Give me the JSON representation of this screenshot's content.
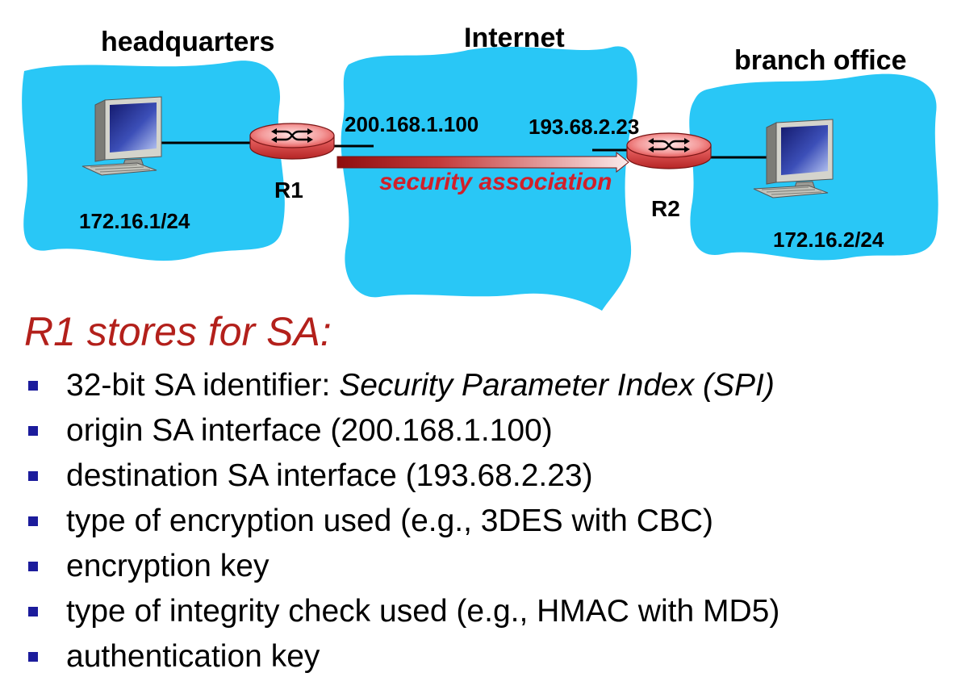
{
  "diagram": {
    "headquarters": {
      "label": "headquarters",
      "subnet": "172.16.1/24",
      "router": "R1"
    },
    "internet": {
      "label": "Internet"
    },
    "branch_office": {
      "label": "branch office",
      "subnet": "172.16.2/24",
      "router": "R2"
    },
    "r1_interface_ip": "200.168.1.100",
    "r2_interface_ip": "193.68.2.23",
    "tunnel_label": "security association"
  },
  "title": "R1 stores for SA:",
  "bullets": [
    {
      "text": "32-bit SA identifier: ",
      "emphasis": "Security Parameter Index (SPI)"
    },
    {
      "text": "origin SA interface (200.168.1.100)"
    },
    {
      "text": "destination SA interface (193.68.2.23)"
    },
    {
      "text": "type of encryption used (e.g., 3DES with CBC)"
    },
    {
      "text": "encryption key"
    },
    {
      "text": "type of integrity check used (e.g., HMAC with MD5)"
    },
    {
      "text": "authentication key"
    }
  ],
  "icons": {
    "host": "desktop-computer-icon",
    "router": "router-icon",
    "bullet": "square-bullet-icon",
    "tunnel": "arrow-right-icon"
  },
  "colors": {
    "cloud": "#29C7F6",
    "title": "#B3201B",
    "tunnel_label": "#D0202A",
    "bullet": "#1C1C9C"
  }
}
